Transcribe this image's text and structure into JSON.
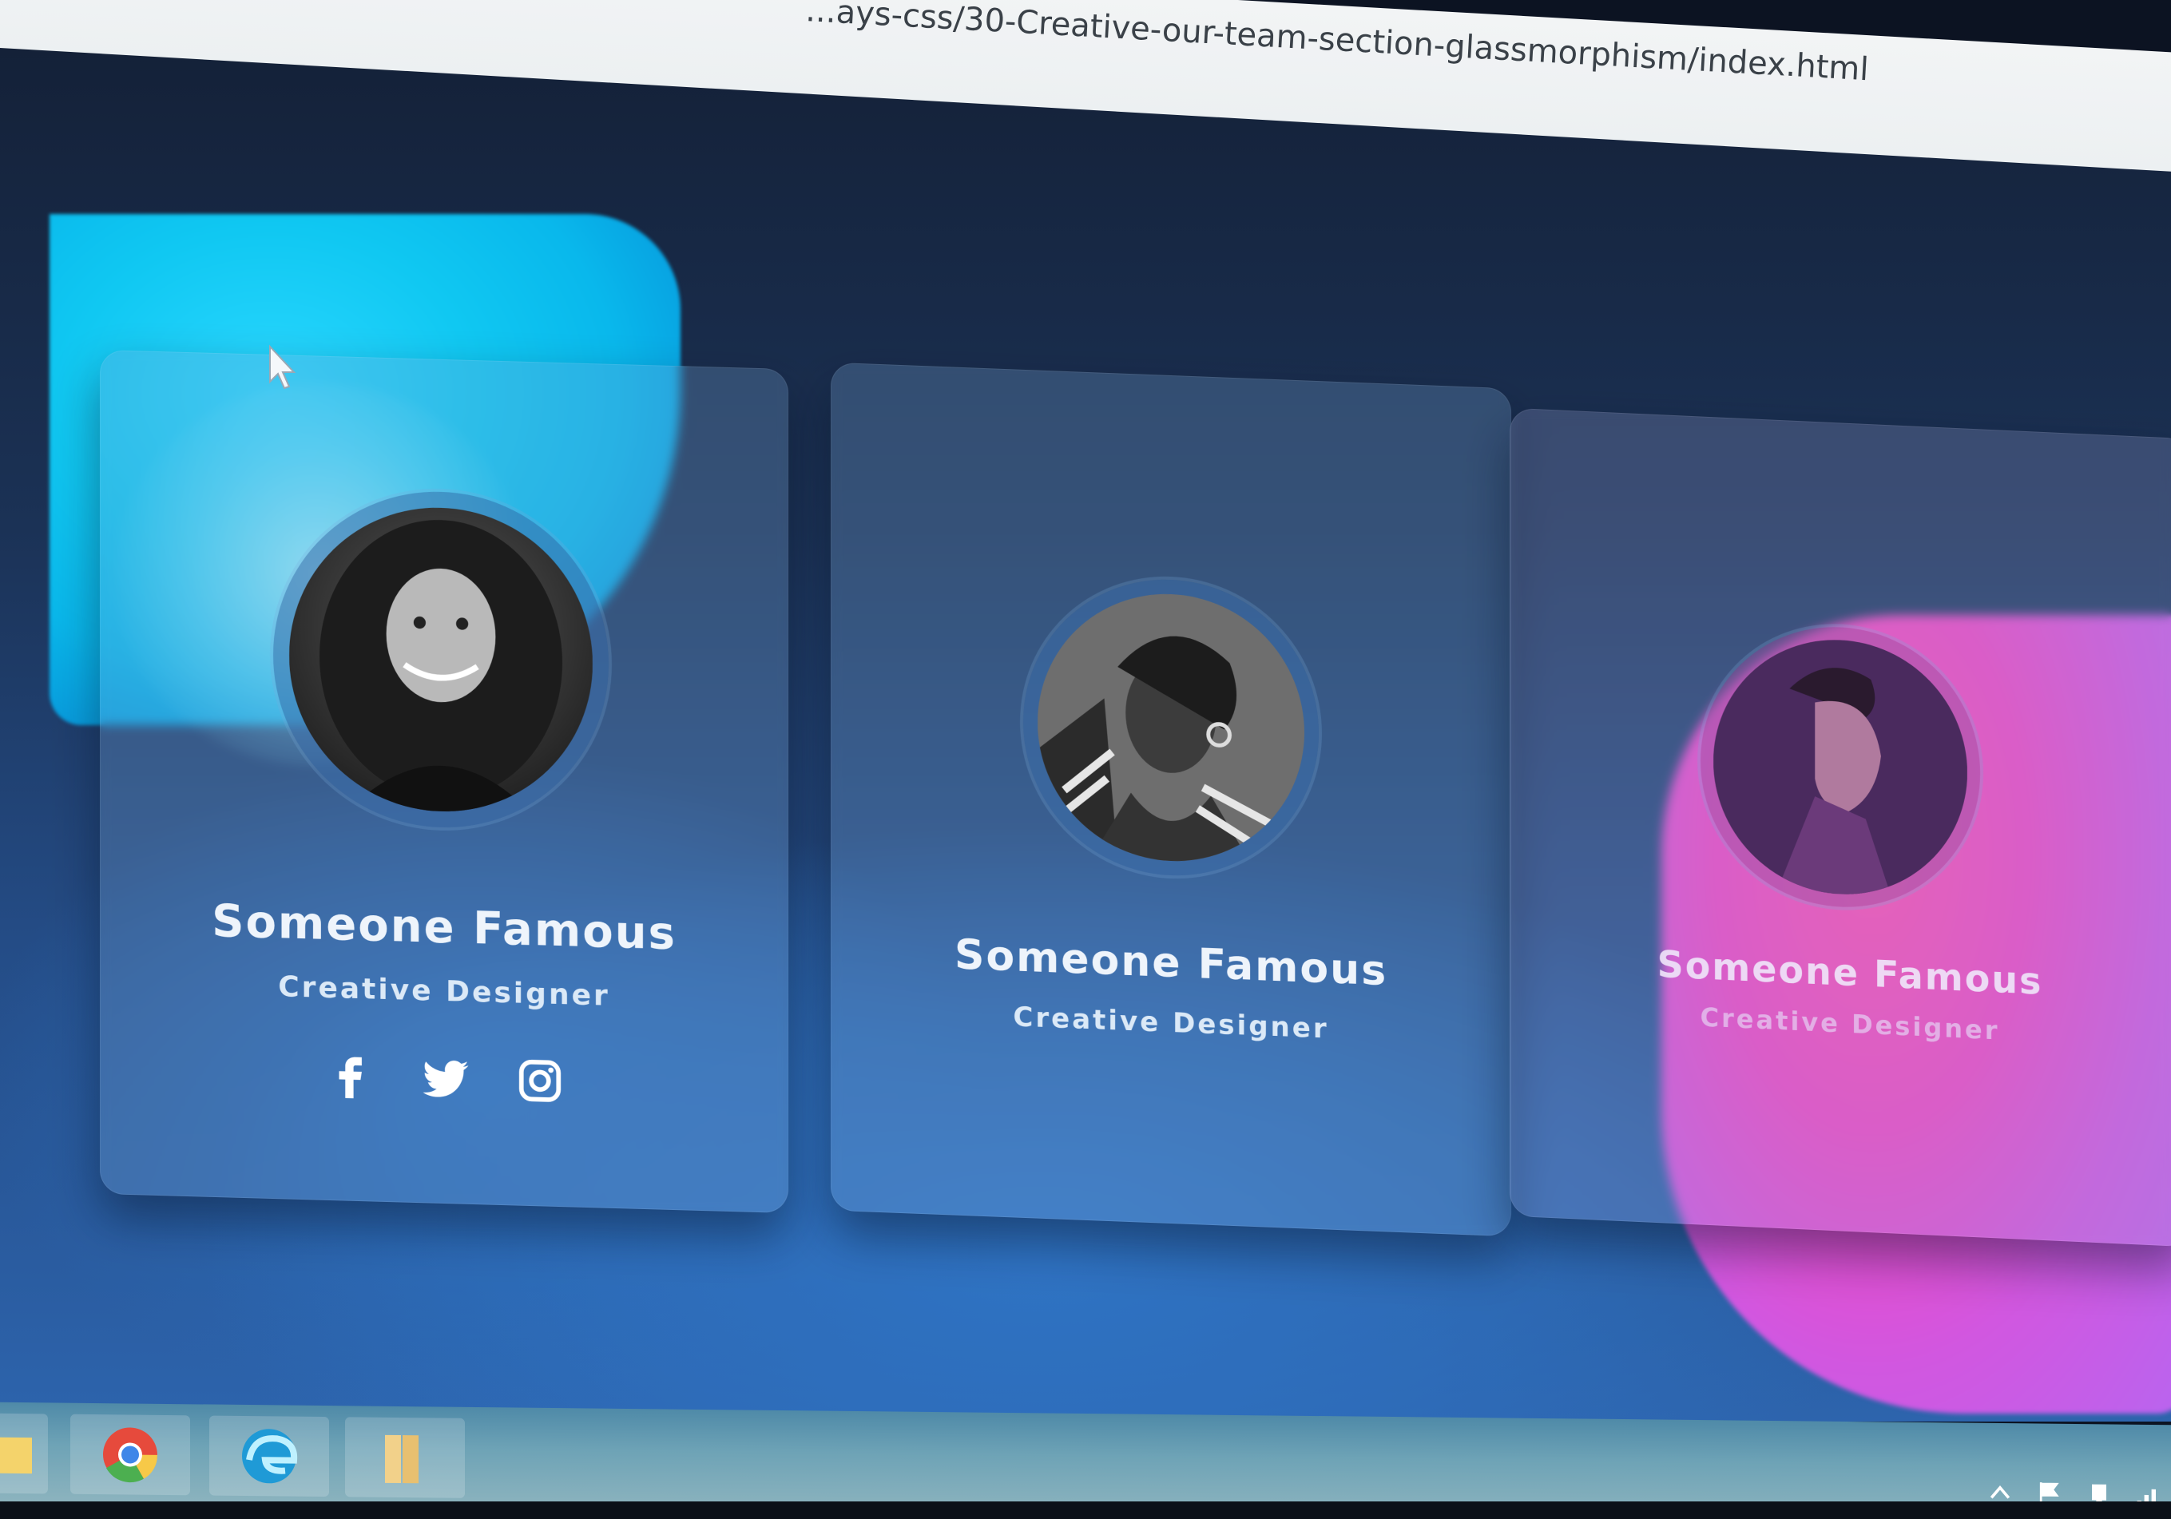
{
  "browser": {
    "url": "...ays-css/30-Creative-our-team-section-glassmorphism/index.html"
  },
  "team": {
    "members": [
      {
        "name": "Someone Famous",
        "role": "Creative Designer",
        "photo": "woman-curly-hair-photo"
      },
      {
        "name": "Someone Famous",
        "role": "Creative Designer",
        "photo": "woman-hand-on-head-photo"
      },
      {
        "name": "Someone Famous",
        "role": "Creative Designer",
        "photo": "man-profile-photo"
      }
    ],
    "social_links": [
      "facebook-icon",
      "twitter-icon",
      "instagram-icon"
    ]
  },
  "colors": {
    "cyan_blob": "#10c8f2",
    "pink_blob": "#f047c4",
    "card_glass": "rgba(120,160,210,0.28)",
    "text": "#eef4fb"
  },
  "taskbar": {
    "apps": [
      "file-explorer-icon",
      "chrome-icon",
      "edge-icon",
      "folder-icon"
    ],
    "tray": [
      "arrow-up-icon",
      "flag-icon",
      "network-icon",
      "signal-icon"
    ]
  }
}
